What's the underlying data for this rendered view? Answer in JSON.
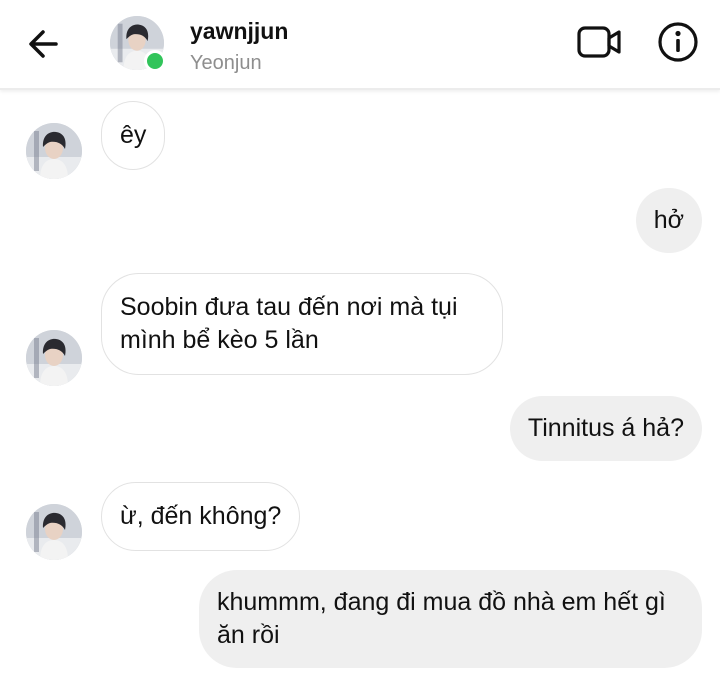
{
  "header": {
    "username": "yawnjjun",
    "display_name": "Yeonjun",
    "back_icon": "arrow-left-icon",
    "video_icon": "video-camera-icon",
    "info_icon": "info-circle-icon",
    "presence_color": "#31c45a"
  },
  "messages": [
    {
      "direction": "incoming",
      "text": "êy"
    },
    {
      "direction": "outgoing",
      "text": "hở"
    },
    {
      "direction": "incoming",
      "text": "Soobin đưa tau đến nơi mà tụi mình bể kèo 5 lần"
    },
    {
      "direction": "outgoing",
      "text": "Tinnitus á hả?"
    },
    {
      "direction": "incoming",
      "text": "ừ, đến không?"
    },
    {
      "direction": "outgoing",
      "text": "khummm, đang đi mua đồ nhà em hết gì ăn rồi"
    }
  ],
  "colors": {
    "incoming_bubble": "#ffffff",
    "incoming_border": "#e2e2e2",
    "outgoing_bubble": "#efefef",
    "muted_text": "#8e8e8e"
  }
}
